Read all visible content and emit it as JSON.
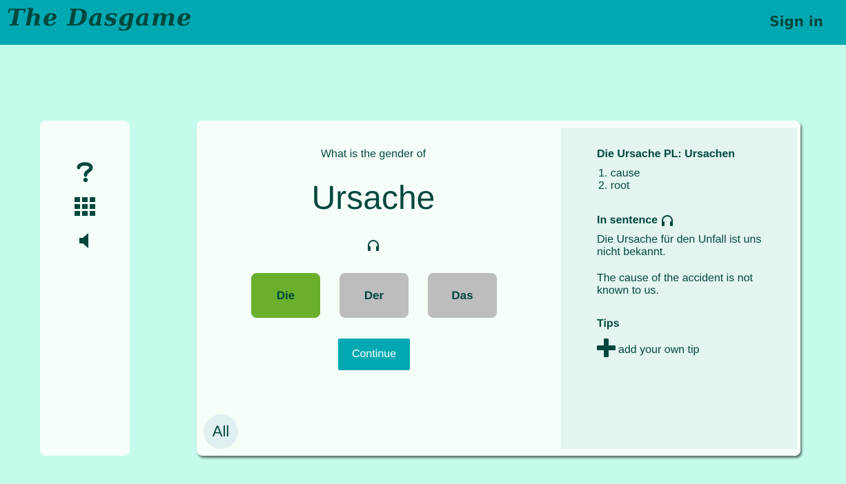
{
  "header": {
    "brand": "The Dasgame",
    "signin_label": "Sign in"
  },
  "sidebar": {
    "icons": [
      "question-icon",
      "grid-icon",
      "speaker-icon"
    ]
  },
  "quiz": {
    "prompt": "What is the gender of",
    "word": "Ursache",
    "options": [
      "Die",
      "Der",
      "Das"
    ],
    "selected": "Die",
    "continue_label": "Continue",
    "all_label": "All"
  },
  "details": {
    "title": "Die Ursache PL: Ursachen",
    "meanings": [
      "1. cause",
      "2. root"
    ],
    "sentence_heading": "In sentence",
    "sentence_de": "Die Ursache für den Unfall ist uns nicht bekannt.",
    "sentence_en": "The cause of the accident is not known to us.",
    "tips_heading": "Tips",
    "add_tip_label": "add your own tip"
  },
  "colors": {
    "background": "#c4fbec",
    "topbar": "#00a9b2",
    "text": "#00473e",
    "selected_option": "#6ab02c",
    "option": "#bdbdbd",
    "panel": "#e3f4f1"
  }
}
